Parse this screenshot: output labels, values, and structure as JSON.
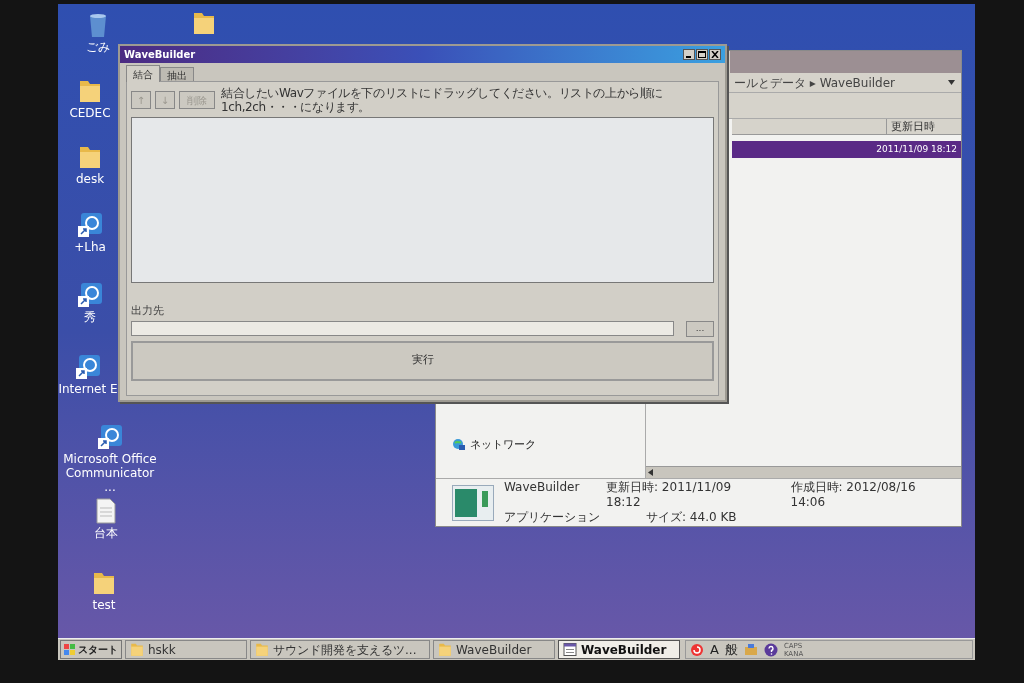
{
  "desktop_icons": [
    {
      "kind": "trash",
      "label": "ごみ"
    },
    {
      "kind": "folder"
    },
    {
      "kind": "folder",
      "label": "CEDEC"
    },
    {
      "kind": "folder",
      "label": "desk"
    },
    {
      "kind": "shortcut",
      "label": "+Lha"
    },
    {
      "kind": "shortcut",
      "label": "秀"
    },
    {
      "kind": "shortcut",
      "label": "Internet E"
    },
    {
      "kind": "shortcut",
      "label": "Microsoft Office Communicator ..."
    },
    {
      "kind": "file",
      "label": "台本"
    },
    {
      "kind": "folder",
      "label": "test"
    }
  ],
  "explorer": {
    "address": "ールとデータ ▸ WaveBuilder",
    "column_header": "更新日時",
    "selected_row_date": "2011/11/09 18:12",
    "nav_item": "ネットワーク",
    "details": {
      "name": "WaveBuilder",
      "modified": "更新日時: 2011/11/09 18:12",
      "created": "作成日時: 2012/08/16 14:06",
      "type": "アプリケーション",
      "size": "サイズ: 44.0 KB"
    }
  },
  "window": {
    "title": "WaveBuilder",
    "tabs": [
      {
        "label": "結合",
        "selected": true
      },
      {
        "label": "抽出",
        "selected": false
      }
    ],
    "buttons": [
      {
        "label": "↑",
        "disabled": true
      },
      {
        "label": "↓",
        "disabled": true
      },
      {
        "label": "削除",
        "disabled": true
      }
    ],
    "instruction": "結合したいWavファイルを下のリストにドラッグしてください。リストの上から順に1ch,2ch・・・になります。",
    "output_label": "出力先",
    "browse_button": "...",
    "run_button": "実行"
  },
  "taskbar": {
    "start": "スタート",
    "tasks": [
      {
        "label": "hskk",
        "kind": "folder",
        "selected": false
      },
      {
        "label": "サウンド開発を支えるツ...",
        "kind": "folder",
        "selected": false
      },
      {
        "label": "WaveBuilder",
        "kind": "folder",
        "selected": false
      },
      {
        "label": "WaveBuilder",
        "kind": "app",
        "selected": true
      }
    ],
    "ime": [
      "A",
      "般"
    ],
    "caps": "CAPS",
    "kana": "KANA"
  }
}
